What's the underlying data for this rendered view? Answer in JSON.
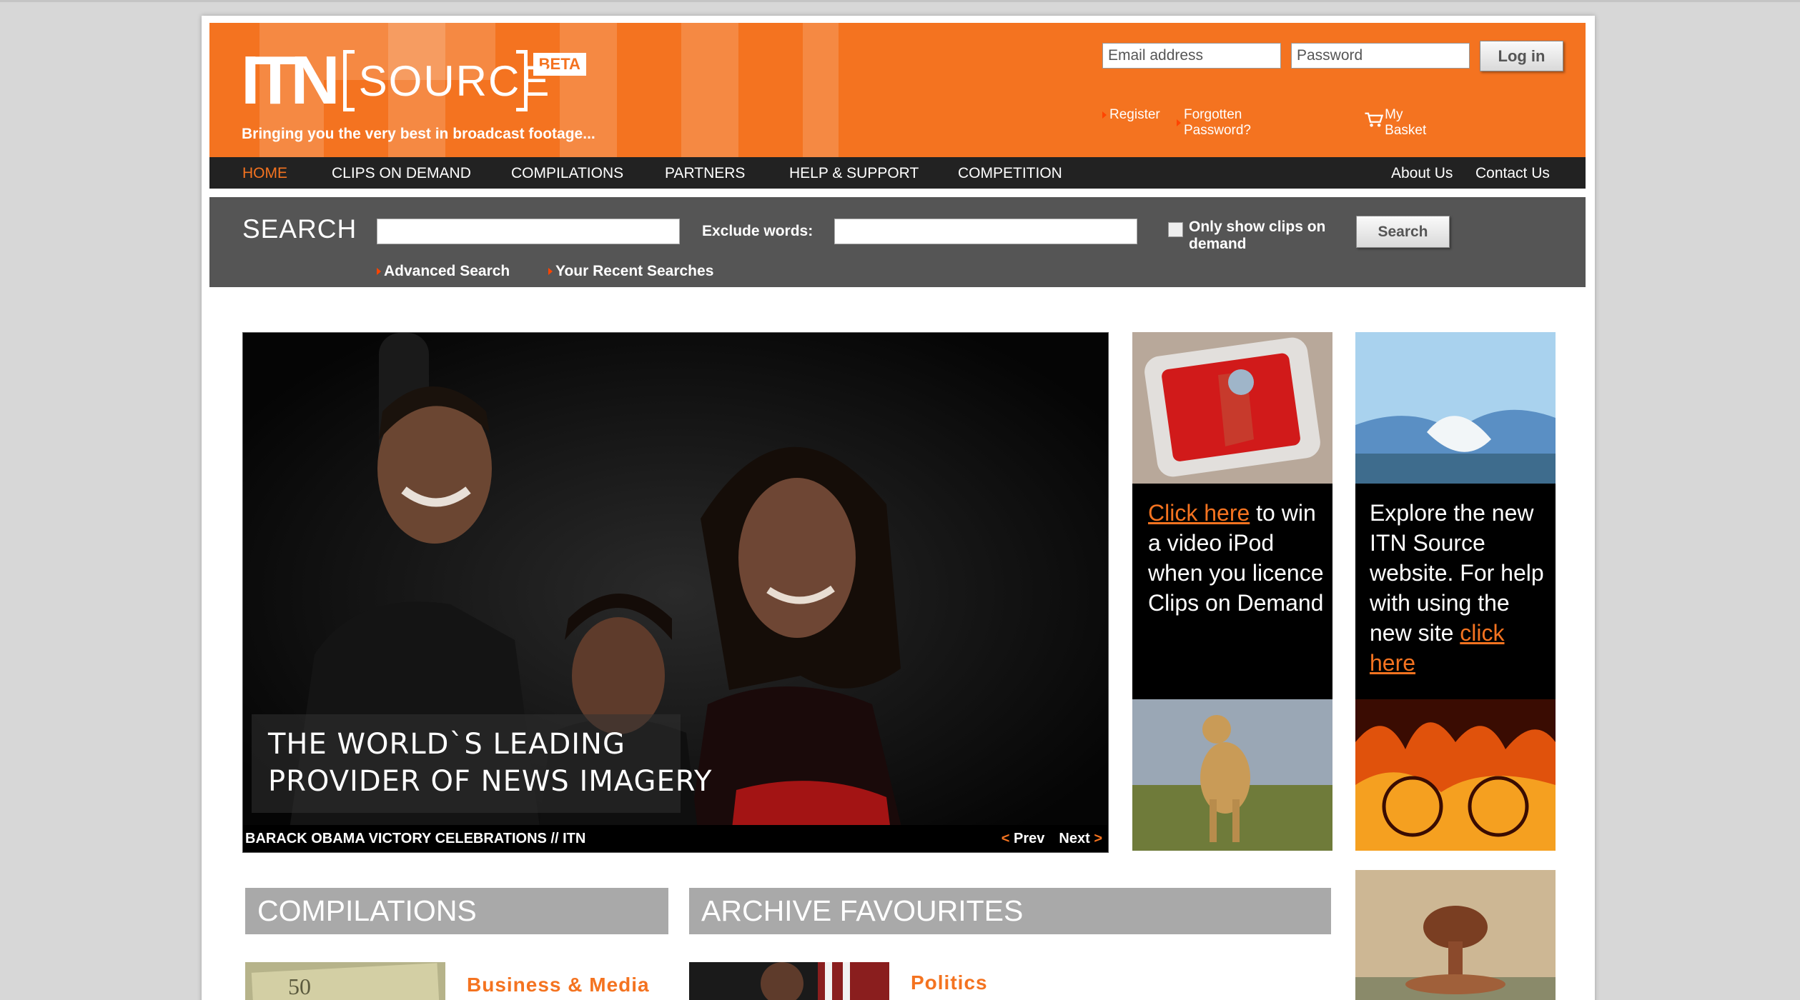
{
  "brand": {
    "logo_itn": "ITN",
    "logo_source": "SOURCE",
    "beta": "BETA",
    "tagline": "Bringing you the very best in broadcast footage..."
  },
  "login": {
    "email_placeholder": "Email address",
    "password_placeholder": "Password",
    "button": "Log in",
    "register": "Register",
    "forgot": "Forgotten Password?",
    "basket": "My Basket"
  },
  "nav": {
    "items": [
      "HOME",
      "CLIPS ON DEMAND",
      "COMPILATIONS",
      "PARTNERS",
      "HELP & SUPPORT",
      "COMPETITION"
    ],
    "active": "HOME",
    "right": [
      "About Us",
      "Contact Us"
    ]
  },
  "search": {
    "label": "SEARCH",
    "exclude_label": "Exclude words:",
    "checkbox_label": "Only show clips on demand",
    "button": "Search",
    "advanced": "Advanced Search",
    "recent": "Your Recent Searches"
  },
  "hero": {
    "headline_1": "THE WORLD`S LEADING",
    "headline_2": "PROVIDER OF NEWS IMAGERY",
    "caption": "BARACK OBAMA VICTORY CELEBRATIONS // ITN",
    "prev": "Prev",
    "next": "Next",
    "prev_arrow": "<",
    "next_arrow": ">"
  },
  "promo1": {
    "link": "Click here",
    "text": " to win a video iPod when you licence Clips on Demand"
  },
  "promo2": {
    "text": "Explore the new ITN Source website. For help with using the new site ",
    "link": "click here"
  },
  "sections": {
    "compilations": "COMPILATIONS",
    "archive": "ARCHIVE FAVOURITES",
    "compilation_item": "Business & Media",
    "archive_item": "Politics"
  },
  "colors": {
    "brand_orange": "#f47320",
    "nav_bg": "#222222",
    "search_bg": "#555555"
  }
}
